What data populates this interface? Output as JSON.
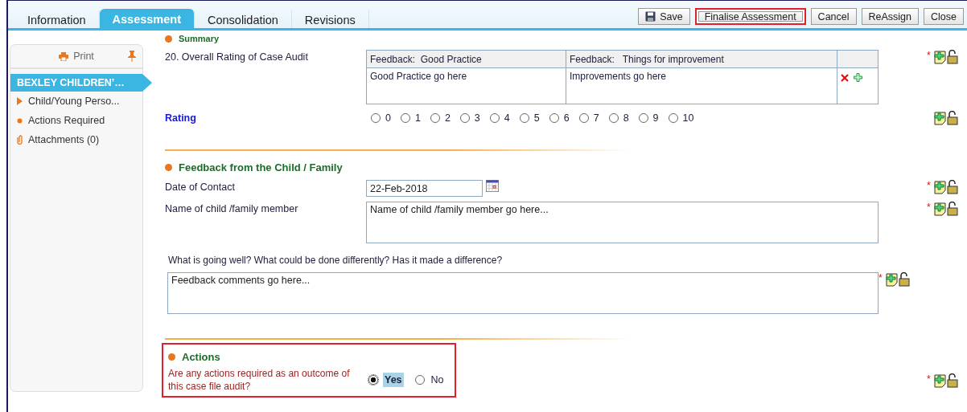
{
  "tabs": [
    {
      "label": "Information",
      "selected": false
    },
    {
      "label": "Assessment",
      "selected": true
    },
    {
      "label": "Consolidation",
      "selected": false
    },
    {
      "label": "Revisions",
      "selected": false
    }
  ],
  "toolbar": [
    {
      "label": "Save",
      "kind": "save",
      "highlighted": false
    },
    {
      "label": "Finalise Assessment",
      "kind": "plain",
      "highlighted": true
    },
    {
      "label": "Cancel",
      "kind": "plain",
      "highlighted": false
    },
    {
      "label": "ReAssign",
      "kind": "plain",
      "highlighted": false
    },
    {
      "label": "Close",
      "kind": "plain",
      "highlighted": false
    }
  ],
  "sidebar": {
    "print": "Print",
    "items": [
      {
        "label": "BEXLEY CHILDREN’…",
        "kind": "header",
        "selected": true
      },
      {
        "label": "Child/Young Perso...",
        "kind": "arrow",
        "selected": false
      },
      {
        "label": "Actions Required",
        "kind": "dot",
        "selected": false
      },
      {
        "label": "Attachments (0)",
        "kind": "clip",
        "selected": false
      }
    ]
  },
  "summary": {
    "heading": "Summary",
    "question": {
      "label": "20. Overall Rating of Case Audit",
      "required_mark": "*"
    },
    "table": {
      "columns": [
        "Feedback:  Good Practice",
        "Feedback:   Things for improvement"
      ],
      "rows": [
        [
          "Good Practice go here",
          "Improvements go here"
        ]
      ]
    },
    "rating": {
      "label": "Rating",
      "options": [
        {
          "label": "0",
          "selected": false
        },
        {
          "label": "1",
          "selected": false
        },
        {
          "label": "2",
          "selected": false
        },
        {
          "label": "3",
          "selected": false
        },
        {
          "label": "4",
          "selected": false
        },
        {
          "label": "5",
          "selected": false
        },
        {
          "label": "6",
          "selected": false
        },
        {
          "label": "7",
          "selected": false
        },
        {
          "label": "8",
          "selected": false
        },
        {
          "label": "9",
          "selected": false
        },
        {
          "label": "10",
          "selected": false
        }
      ]
    }
  },
  "feedback": {
    "heading": "Feedback from the Child / Family",
    "fields": [
      {
        "kind": "date",
        "label": "Date of Contact",
        "value": "22-Feb-2018",
        "required_mark": "*"
      },
      {
        "kind": "textarea",
        "label": "Name of child /family member",
        "value": "Name of child /family member go here...",
        "required_mark": "*"
      },
      {
        "kind": "wide",
        "label": "What is going well?  What could be done differently? Has it made a difference?",
        "value": "Feedback comments go here...",
        "required_mark": "*"
      }
    ]
  },
  "actions": {
    "heading": "Actions",
    "highlighted": true,
    "question": "Are any actions required as an outcome of this case file audit?",
    "required_mark": "*",
    "options": [
      {
        "label": "Yes",
        "selected": true
      },
      {
        "label": "No",
        "selected": false
      }
    ]
  }
}
